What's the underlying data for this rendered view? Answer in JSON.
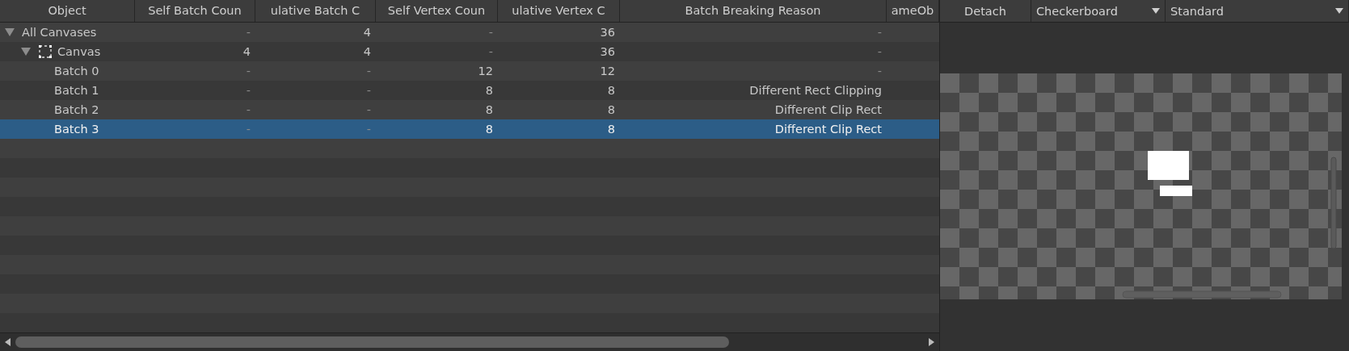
{
  "columns": [
    {
      "label": "Object"
    },
    {
      "label": "Self Batch Coun"
    },
    {
      "label": "ulative Batch C"
    },
    {
      "label": "Self Vertex Coun"
    },
    {
      "label": "ulative Vertex C"
    },
    {
      "label": "Batch Breaking Reason"
    },
    {
      "label": "ameOb"
    }
  ],
  "tree": [
    {
      "name": "All Canvases",
      "expanded": true,
      "selected": false,
      "values": [
        "-",
        "4",
        "-",
        "36",
        "-"
      ],
      "children": [
        {
          "name": "Canvas",
          "kind": "canvas",
          "expanded": true,
          "selected": false,
          "values": [
            "4",
            "4",
            "-",
            "36",
            "-"
          ],
          "children": [
            {
              "name": "Batch 0",
              "selected": false,
              "values": [
                "-",
                "-",
                "12",
                "12",
                "-"
              ]
            },
            {
              "name": "Batch 1",
              "selected": false,
              "values": [
                "-",
                "-",
                "8",
                "8",
                "Different Rect Clipping"
              ]
            },
            {
              "name": "Batch 2",
              "selected": false,
              "values": [
                "-",
                "-",
                "8",
                "8",
                "Different Clip Rect"
              ]
            },
            {
              "name": "Batch 3",
              "selected": true,
              "values": [
                "-",
                "-",
                "8",
                "8",
                "Different Clip Rect"
              ]
            }
          ]
        }
      ]
    }
  ],
  "preview": {
    "detach_button": "Detach",
    "background_dropdown": "Checkerboard",
    "mode_dropdown": "Standard"
  }
}
